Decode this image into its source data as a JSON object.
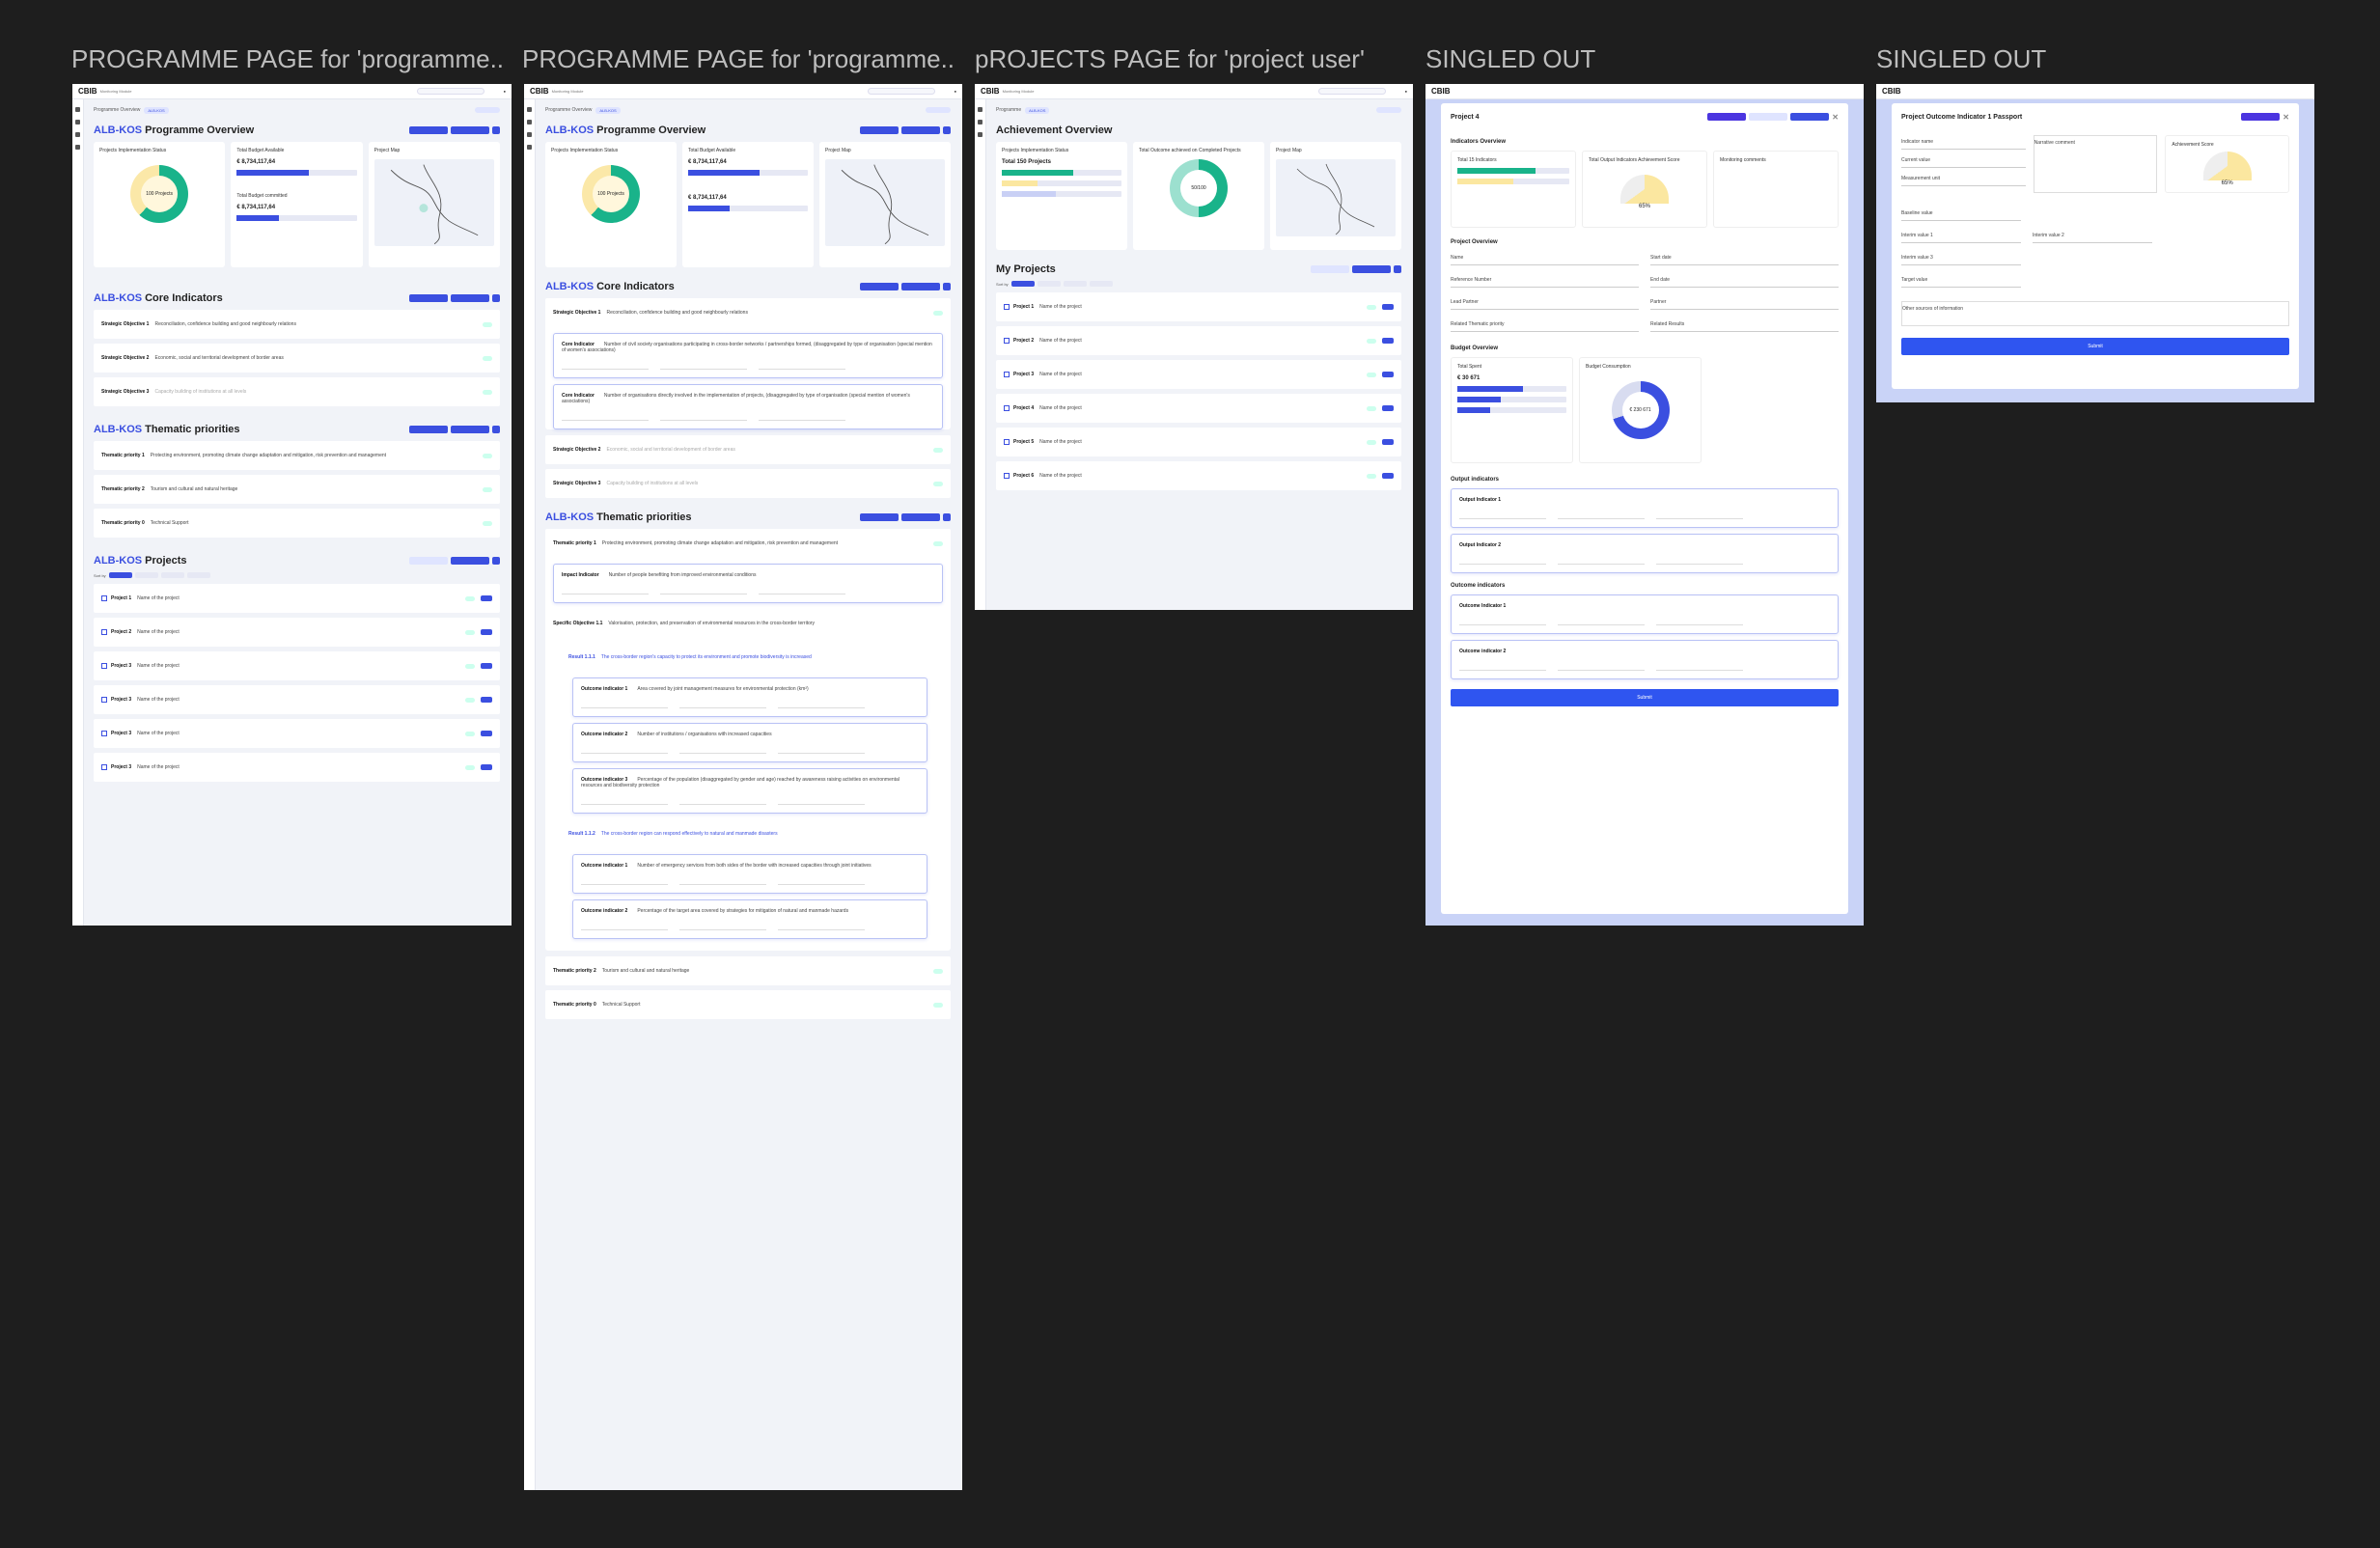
{
  "frames": [
    {
      "title": "PROGRAMME PAGE for 'programme..."
    },
    {
      "title": "PROGRAMME PAGE for 'programme..."
    },
    {
      "title": "pROJECTS PAGE for 'project user'"
    },
    {
      "title": "SINGLED OUT"
    },
    {
      "title": "SINGLED OUT"
    }
  ],
  "app": {
    "logo": "CBIB",
    "logo_sub": "Monitoring Module"
  },
  "f1": {
    "breadcrumb": "Programme Overview",
    "breadcrumb_pill": "ALB-KOS",
    "overview_prefix": "ALB-KOS",
    "overview_title": "Programme Overview",
    "card1_title": "Projects Implementation Status",
    "donut_center": "100 Projects",
    "card2_title": "Total Budget Available",
    "budget_available": "€ 8,734,117,64",
    "budget_committed_label": "Total Budget committed",
    "budget_committed": "€ 8,734,117,64",
    "card3_title": "Project Map",
    "core_title": "Core Indicators",
    "objectives": [
      {
        "label": "Strategic Objective 1",
        "text": "Reconciliation, confidence building and good neighbourly relations"
      },
      {
        "label": "Strategic Objective 2",
        "text": "Economic, social and territorial development of border areas"
      },
      {
        "label": "Strategic Objective 3",
        "text": "Capacity building of institutions at all levels"
      }
    ],
    "thematic_title": "Thematic priorities",
    "priorities": [
      {
        "label": "Thematic priority 1",
        "text": "Protecting environment, promoting climate change adaptation and mitigation, risk prevention and management"
      },
      {
        "label": "Thematic priority 2",
        "text": "Tourism and cultural and natural heritage"
      },
      {
        "label": "Thematic priority 0",
        "text": "Technical Support"
      }
    ],
    "projects_title": "Projects",
    "sort_by": "Sort by",
    "projects": [
      {
        "label": "Project 1",
        "name": "Name of the project"
      },
      {
        "label": "Project 2",
        "name": "Name of the project"
      },
      {
        "label": "Project 3",
        "name": "Name of the project"
      },
      {
        "label": "Project 3",
        "name": "Name of the project"
      },
      {
        "label": "Project 3",
        "name": "Name of the project"
      },
      {
        "label": "Project 3",
        "name": "Name of the project"
      }
    ]
  },
  "f2": {
    "breadcrumb": "Programme Overview",
    "overview_prefix": "ALB-KOS",
    "overview_title": "Programme Overview",
    "core_title": "Core Indicators",
    "objective1": "Strategic Objective 1",
    "objective1_text": "Reconciliation, confidence building and good neighbourly relations",
    "core_indicators": [
      {
        "label": "Core Indicator",
        "text": "Number of civil society organisations participating in cross-border networks / partnerships formed, (disaggregated by type of organisation (special mention of women's associations)"
      },
      {
        "label": "Core Indicator",
        "text": "Number of organisations directly involved in the implementation of projects, (disaggregated by type of organisation (special mention of women's associations)"
      }
    ],
    "objective2": "Strategic Objective 2",
    "objective2_text": "Economic, social and territorial development of border areas",
    "objective3": "Strategic Objective 3",
    "objective3_text": "Capacity building of institutions at all levels",
    "thematic_title": "Thematic priorities",
    "priority1": "Thematic priority 1",
    "priority1_text": "Protecting environment, promoting climate change adaptation and mitigation, risk prevention and management",
    "impact_label": "Impact Indicator",
    "impact_text": "Number of people benefiting from improved environmental conditions",
    "specific_objective": "Specific Objective 1.1",
    "specific_text": "Valorisation, protection, and preservation of environmental resources in the cross-border territory",
    "result1": "Result 1.1.1",
    "result1_text": "The cross-border region's capacity to protect its environment and promote biodiversity is increased",
    "outcomes_a": [
      {
        "label": "Outcome indicator 1",
        "text": "Area covered by joint management measures for environmental protection (km²)"
      },
      {
        "label": "Outcome indicator 2",
        "text": "Number of institutions / organisations with increased capacities"
      },
      {
        "label": "Outcome indicator 3",
        "text": "Percentage of the population (disaggregated by gender and age) reached by awareness raising activities on environmental resources and biodiversity protection"
      }
    ],
    "result2": "Result 1.1.2",
    "result2_text": "The cross-border region can respond effectively to natural and manmade disasters",
    "outcomes_b": [
      {
        "label": "Outcome indicator 1",
        "text": "Number of emergency services from both sides of the border with increased capacities through joint initiatives"
      },
      {
        "label": "Outcome indicator 2",
        "text": "Percentage of the target area covered by strategies for mitigation of natural and manmade hazards"
      }
    ],
    "priority2": "Thematic priority 2",
    "priority2_text": "Tourism and cultural and natural heritage",
    "priority0": "Thematic priority 0",
    "priority0_text": "Technical Support"
  },
  "f3": {
    "breadcrumb": "Programme",
    "title": "Achievement Overview",
    "card1_title": "Projects Implementation Status",
    "card1_total": "Total 150 Projects",
    "card2_title": "Total Outcome achieved on Completed Projects",
    "donut_center": "50/100",
    "card3_title": "Project Map",
    "projects_title": "My Projects",
    "sort_by": "Sort by",
    "projects": [
      {
        "label": "Project 1",
        "name": "Name of the project"
      },
      {
        "label": "Project 2",
        "name": "Name of the project"
      },
      {
        "label": "Project 3",
        "name": "Name of the project"
      },
      {
        "label": "Project 4",
        "name": "Name of the project"
      },
      {
        "label": "Project 5",
        "name": "Name of the project"
      },
      {
        "label": "Project 6",
        "name": "Name of the project"
      }
    ]
  },
  "f4": {
    "title": "Project 4",
    "indicators_overview": "Indicators Overview",
    "total_indicators": "Total 15 Indicators",
    "output_achieved": "Total Output Indicators Achievement Score",
    "gauge_value": "65%",
    "comments": "Monitoring comments",
    "project_overview": "Project Overview",
    "fields": [
      "Name",
      "Start date",
      "Reference Number",
      "End date",
      "Lead Partner",
      "Partner",
      "Related Thematic priority",
      "Related Results",
      "Description"
    ],
    "budget_overview": "Budget Overview",
    "total_spent_label": "Total Spent",
    "total_spent": "€ 30 671",
    "consumption_label": "Budget Consumption",
    "consumption_center": "€ 230 671",
    "output_indicators": "Output indicators",
    "outputs": [
      "Output Indicator 1",
      "Output Indicator 2"
    ],
    "outcome_indicators": "Outcome indicators",
    "outcomes": [
      "Outcome Indicator 1",
      "Outcome indicator 2"
    ],
    "submit": "Submit"
  },
  "f5": {
    "title": "Project Outcome Indicator 1 Passport",
    "fields": [
      "Indicator name",
      "Current value",
      "Measurement unit",
      "Baseline value",
      "Interim value 1",
      "Interim value 2",
      "Interim value 3",
      "Target value",
      "Other sources of information"
    ],
    "narrative": "Narrative comment",
    "score": "Achievement Score",
    "score_value": "65%",
    "submit": "Submit"
  }
}
